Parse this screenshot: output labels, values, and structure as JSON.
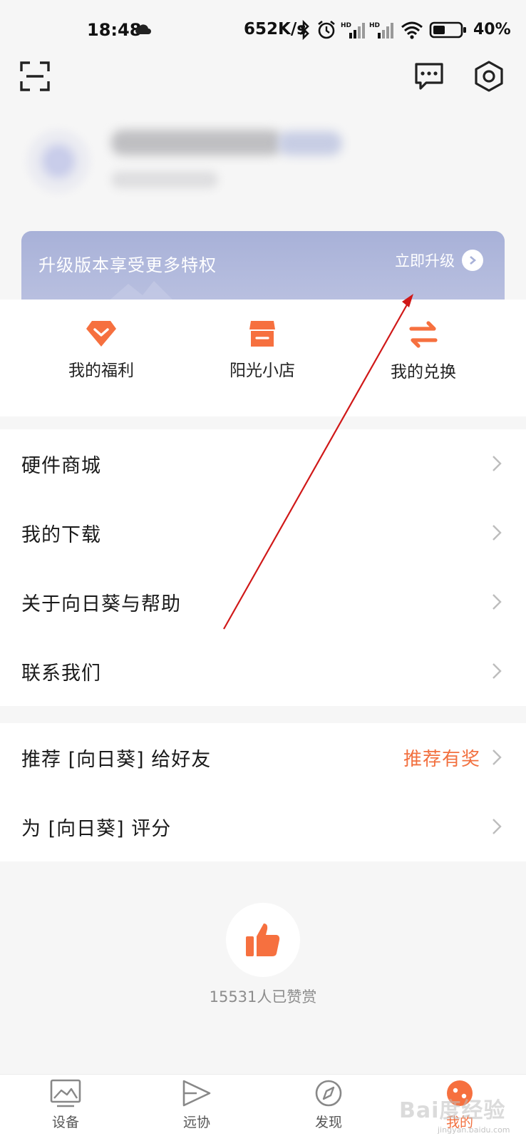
{
  "status_bar": {
    "time": "18:48",
    "net_speed": "652K/s",
    "battery": "40%",
    "icons": [
      "cloud-icon",
      "bluetooth-icon",
      "alarm-icon",
      "signal-hd-icon",
      "signal-hd-icon",
      "wifi-icon",
      "battery-icon"
    ]
  },
  "header": {
    "icons": [
      "scan-icon",
      "message-icon",
      "settings-icon"
    ]
  },
  "upgrade_banner": {
    "text": "升级版本享受更多特权",
    "link": "立即升级"
  },
  "quick_actions": [
    {
      "label": "我的福利",
      "icon": "gift-diamond-icon"
    },
    {
      "label": "阳光小店",
      "icon": "store-icon"
    },
    {
      "label": "我的兑换",
      "icon": "exchange-icon"
    }
  ],
  "menu_group_1": [
    {
      "label": "硬件商城"
    },
    {
      "label": "我的下载"
    },
    {
      "label": "关于向日葵与帮助"
    },
    {
      "label": "联系我们"
    }
  ],
  "menu_group_2": [
    {
      "label": "推荐 [向日葵] 给好友",
      "extra": "推荐有奖"
    },
    {
      "label": "为 [向日葵] 评分"
    }
  ],
  "like": {
    "count_text": "15531人已赞赏",
    "icon": "thumbs-up-icon"
  },
  "bottom_nav": [
    {
      "label": "设备",
      "icon": "device-icon"
    },
    {
      "label": "远协",
      "icon": "remote-assist-icon"
    },
    {
      "label": "发现",
      "icon": "compass-icon"
    },
    {
      "label": "我的",
      "icon": "profile-icon",
      "active": true
    }
  ],
  "watermark": {
    "text": "Bai度经验",
    "sub": "jingyan.baidu.com"
  },
  "colors": {
    "accent": "#f2703f",
    "banner": "#aeb6dc",
    "arrow": "#d01818"
  }
}
